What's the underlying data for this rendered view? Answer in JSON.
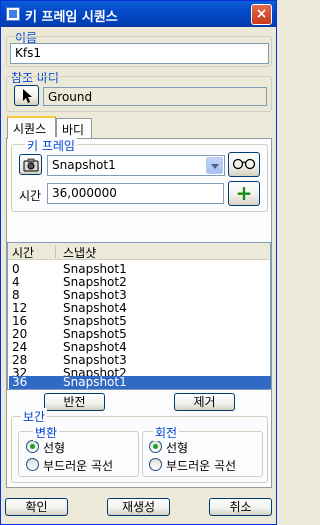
{
  "window": {
    "title": "키 프레임 시퀀스",
    "close_glyph": "×"
  },
  "name_section": {
    "label": "이름",
    "value": "Kfs1"
  },
  "ref_body": {
    "label": "참조 바디",
    "value": "Ground"
  },
  "tabs": [
    {
      "label": "시퀀스",
      "active": true
    },
    {
      "label": "바디",
      "active": false
    }
  ],
  "keyframe": {
    "label": "키 프레임",
    "snapshot_selected": "Snapshot1",
    "time_label": "시간",
    "time_value": "36,000000",
    "add_glyph": "+"
  },
  "list": {
    "headers": [
      "시간",
      "스냅샷"
    ],
    "rows": [
      {
        "time": "0",
        "snapshot": "Snapshot1"
      },
      {
        "time": "4",
        "snapshot": "Snapshot2"
      },
      {
        "time": "8",
        "snapshot": "Snapshot3"
      },
      {
        "time": "12",
        "snapshot": "Snapshot4"
      },
      {
        "time": "16",
        "snapshot": "Snapshot5"
      },
      {
        "time": "20",
        "snapshot": "Snapshot5"
      },
      {
        "time": "24",
        "snapshot": "Snapshot4"
      },
      {
        "time": "28",
        "snapshot": "Snapshot3"
      },
      {
        "time": "32",
        "snapshot": "Snapshot2"
      },
      {
        "time": "36",
        "snapshot": "Snapshot1"
      }
    ],
    "selected_index": 9
  },
  "list_buttons": {
    "reverse": "반전",
    "remove": "제거"
  },
  "interpolation": {
    "label": "보간",
    "translation": {
      "label": "변환",
      "options": [
        "선형",
        "부드러운 곡선"
      ],
      "selected": 0
    },
    "rotation": {
      "label": "회전",
      "options": [
        "선형",
        "부드러운 곡선"
      ],
      "selected": 0
    }
  },
  "footer": {
    "ok": "확인",
    "regenerate": "재생성",
    "cancel": "취소"
  },
  "colors": {
    "title_blue": "#0349c8",
    "label_blue": "#0046d5",
    "selection": "#316ac5",
    "add_green": "#1a8a1a"
  }
}
